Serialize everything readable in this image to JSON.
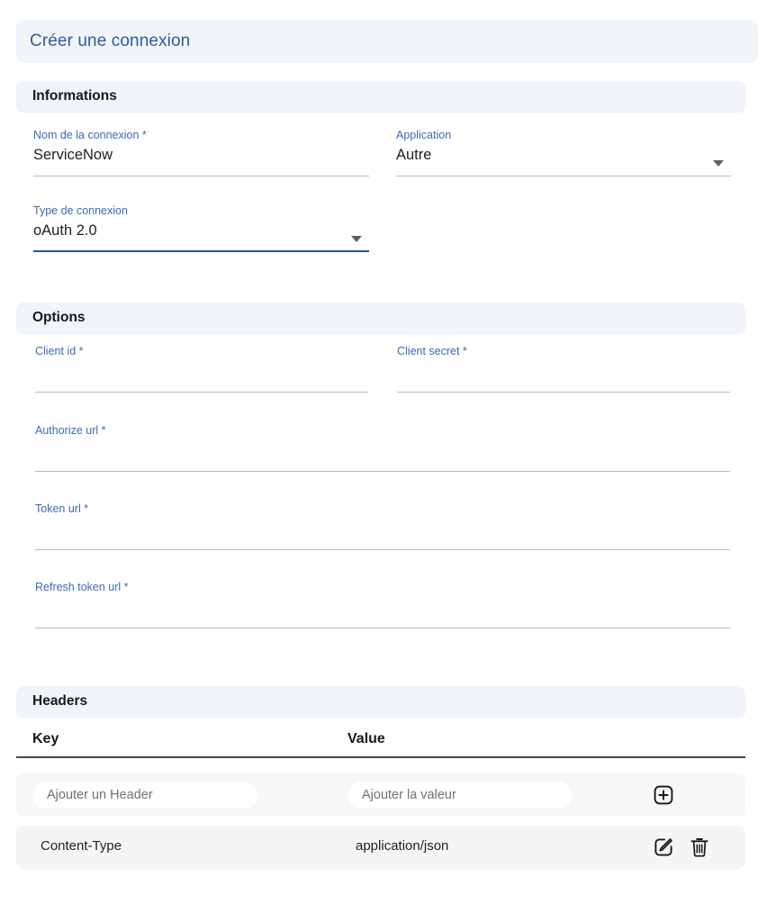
{
  "page": {
    "title": "Créer une connexion"
  },
  "sections": {
    "informations": {
      "heading": "Informations",
      "fields": [
        {
          "label": "Nom de la connexion *",
          "value": "ServiceNow",
          "type": "text",
          "focused": false
        },
        {
          "label": "Application",
          "value": "Autre",
          "type": "select",
          "focused": false
        },
        {
          "label": "Type de connexion",
          "value": "oAuth 2.0",
          "type": "select",
          "focused": true
        }
      ]
    },
    "options": {
      "heading": "Options",
      "fields": [
        {
          "label": "Client id *",
          "value": "",
          "type": "text",
          "focused": false
        },
        {
          "label": "Client secret *",
          "value": "",
          "type": "text",
          "focused": false
        },
        {
          "label": "Authorize url *",
          "value": "",
          "type": "text",
          "focused": false
        },
        {
          "label": "Token url *",
          "value": "",
          "type": "text",
          "focused": false
        },
        {
          "label": "Refresh token url *",
          "value": "",
          "type": "text",
          "focused": false
        }
      ]
    },
    "headers": {
      "heading": "Headers",
      "columns": [
        "Key",
        "Value"
      ],
      "add_row": {
        "key_placeholder": "Ajouter un Header",
        "value_placeholder": "Ajouter la valeur",
        "action_icon": "plus-square-icon"
      },
      "rows": [
        {
          "key": "Content-Type",
          "value": "application/json",
          "action_icons": [
            "edit-square-icon",
            "trash-icon"
          ]
        }
      ]
    }
  },
  "colors": {
    "accent_blue": "#2f5aa0",
    "label_blue": "#3c6bb2",
    "bar_background": "#f1f4f9",
    "row_background": "#f7f7f8",
    "focused_underline": "#2a5599",
    "underline": "#b9b9b9"
  }
}
